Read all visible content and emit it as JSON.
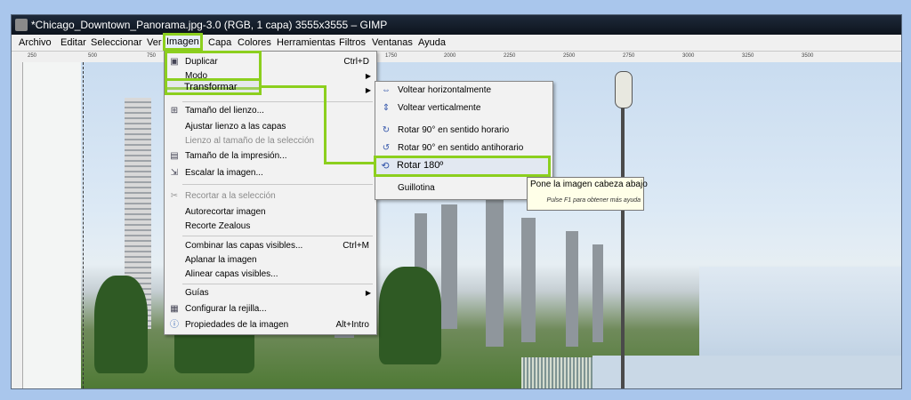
{
  "window": {
    "title": "*Chicago_Downtown_Panorama.jpg-3.0 (RGB, 1 capa) 3555x3555 – GIMP"
  },
  "menubar": {
    "items": [
      "Archivo",
      "Editar",
      "Seleccionar",
      "Ver",
      "Imagen",
      "Capa",
      "Colores",
      "Herramientas",
      "Filtros",
      "Ventanas",
      "Ayuda"
    ],
    "active": "Imagen"
  },
  "ruler": {
    "ticks": [
      "250",
      "500",
      "750",
      "1000",
      "1250",
      "1500",
      "1750",
      "2000",
      "2250",
      "2500",
      "2750",
      "3000",
      "3250",
      "3500"
    ]
  },
  "imagen_menu": {
    "duplicar": "Duplicar",
    "duplicar_sc": "Ctrl+D",
    "modo": "Modo",
    "transformar": "Transformar",
    "tamano_lienzo": "Tamaño del lienzo...",
    "ajustar_lienzo": "Ajustar lienzo a las capas",
    "lienzo_seleccion": "Lienzo al tamaño de la selección",
    "tamano_impresion": "Tamaño de la impresión...",
    "escalar": "Escalar la imagen...",
    "recortar_seleccion": "Recortar a la selección",
    "autorecortar": "Autorecortar imagen",
    "recorte_zealous": "Recorte Zealous",
    "combinar": "Combinar las capas visibles...",
    "combinar_sc": "Ctrl+M",
    "aplanar": "Aplanar la imagen",
    "alinear": "Alinear capas visibles...",
    "guias": "Guías",
    "rejilla": "Configurar la rejilla...",
    "propiedades": "Propiedades de la imagen",
    "propiedades_sc": "Alt+Intro"
  },
  "transformar_menu": {
    "voltear_h": "Voltear horizontalmente",
    "voltear_v": "Voltear verticalmente",
    "rotar_90_h": "Rotar 90° en sentido horario",
    "rotar_90_ah": "Rotar 90° en sentido antihorario",
    "rotar_180": "Rotar 180º",
    "guillotina": "Guillotina"
  },
  "tooltip": {
    "text": "Pone la imagen cabeza abajo",
    "hint": "Pulse F1 para obtener más ayuda"
  },
  "colors": {
    "highlight": "#8ccf1e",
    "background": "#a9c6ec"
  }
}
